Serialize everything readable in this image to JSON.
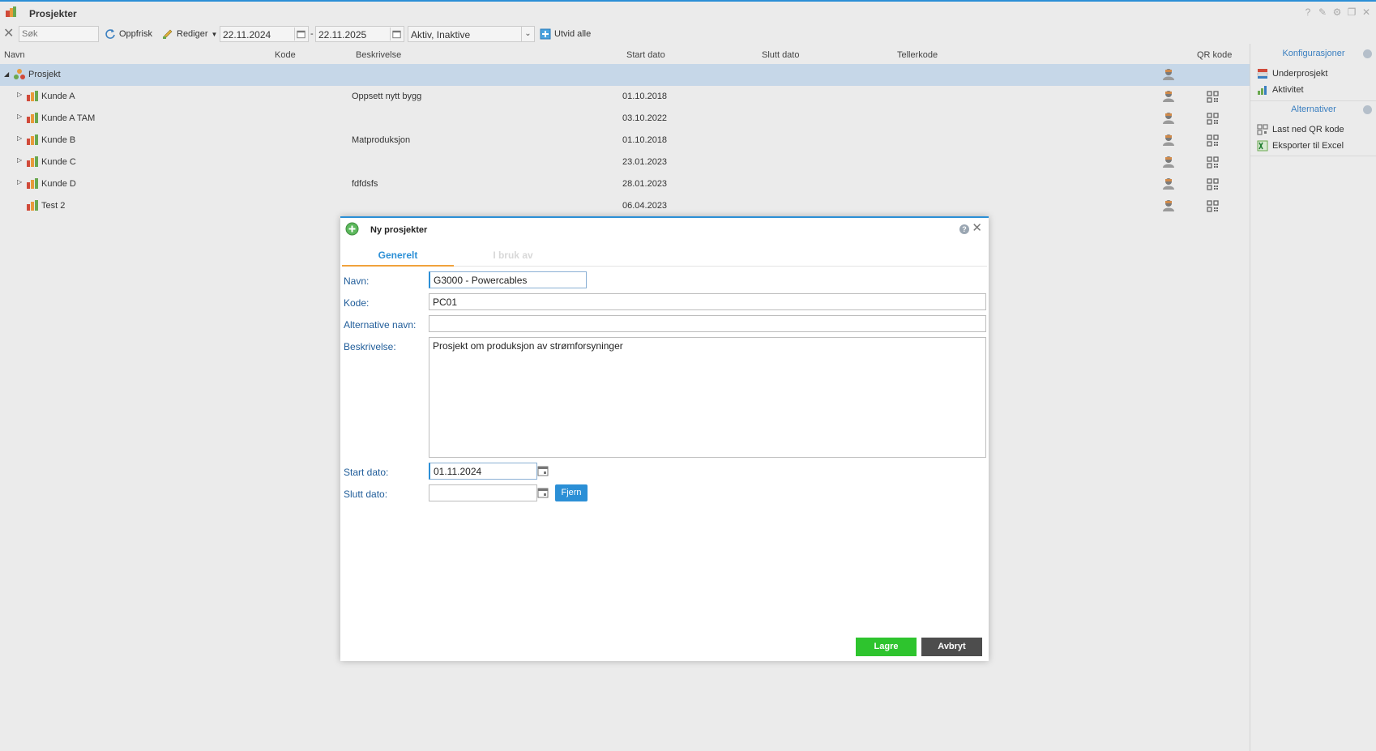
{
  "window": {
    "title": "Prosjekter"
  },
  "toolbar": {
    "search_placeholder": "Søk",
    "refresh_label": "Oppfrisk",
    "edit_label": "Rediger",
    "date_from": "22.11.2024",
    "date_separator": "-",
    "date_to": "22.11.2025",
    "status_filter": "Aktiv, Inaktive",
    "expand_all_label": "Utvid alle"
  },
  "grid": {
    "columns": {
      "name": "Navn",
      "code": "Kode",
      "description": "Beskrivelse",
      "start_date": "Start dato",
      "end_date": "Slutt dato",
      "counter_code": "Tellerkode",
      "qr_code": "QR kode"
    },
    "root": {
      "name": "Prosjekt"
    },
    "rows": [
      {
        "name": "Kunde A",
        "code": "",
        "description": "Oppsett nytt bygg",
        "start_date": "01.10.2018",
        "end_date": "",
        "counter_code": ""
      },
      {
        "name": "Kunde A TAM",
        "code": "",
        "description": "",
        "start_date": "03.10.2022",
        "end_date": "",
        "counter_code": ""
      },
      {
        "name": "Kunde B",
        "code": "",
        "description": "Matproduksjon",
        "start_date": "01.10.2018",
        "end_date": "",
        "counter_code": ""
      },
      {
        "name": "Kunde C",
        "code": "",
        "description": "",
        "start_date": "23.01.2023",
        "end_date": "",
        "counter_code": ""
      },
      {
        "name": "Kunde D",
        "code": "",
        "description": "fdfdsfs",
        "start_date": "28.01.2023",
        "end_date": "",
        "counter_code": ""
      },
      {
        "name": "Test 2",
        "code": "",
        "description": "",
        "start_date": "06.04.2023",
        "end_date": "",
        "counter_code": ""
      }
    ]
  },
  "side_panel": {
    "configurations_title": "Konfigurasjoner",
    "subproject_label": "Underprosjekt",
    "activity_label": "Aktivitet",
    "alternatives_title": "Alternativer",
    "download_qr_label": "Last ned QR kode",
    "export_excel_label": "Eksporter til Excel"
  },
  "dialog": {
    "title": "Ny prosjekter",
    "tabs": {
      "general": "Generelt",
      "in_use_by": "I bruk av"
    },
    "fields": {
      "name_label": "Navn:",
      "name_value": "G3000 - Powercables",
      "code_label": "Kode:",
      "code_value": "PC01",
      "alt_name_label": "Alternative navn:",
      "alt_name_value": "",
      "description_label": "Beskrivelse:",
      "description_value": "Prosjekt om produksjon av strømforsyninger",
      "start_date_label": "Start dato:",
      "start_date_value": "01.11.2024",
      "end_date_label": "Slutt dato:",
      "end_date_value": "",
      "remove_label": "Fjern"
    },
    "save_label": "Lagre",
    "cancel_label": "Avbryt"
  },
  "colors": {
    "accent": "#2b8fd6",
    "selected_row": "#c6d7e8",
    "save_button": "#2ec42e",
    "cancel_button": "#4d4d4d",
    "remove_button": "#2b8fd6",
    "tab_underline": "#f0a23c",
    "field_label": "#1f5c99"
  },
  "icons": {
    "app": "project-tree-icon",
    "refresh": "refresh-icon",
    "edit": "edit-icon",
    "expand_all": "expand-all-icon",
    "person": "person-icon",
    "qr": "qr-code-icon",
    "new": "plus-circle-icon"
  }
}
